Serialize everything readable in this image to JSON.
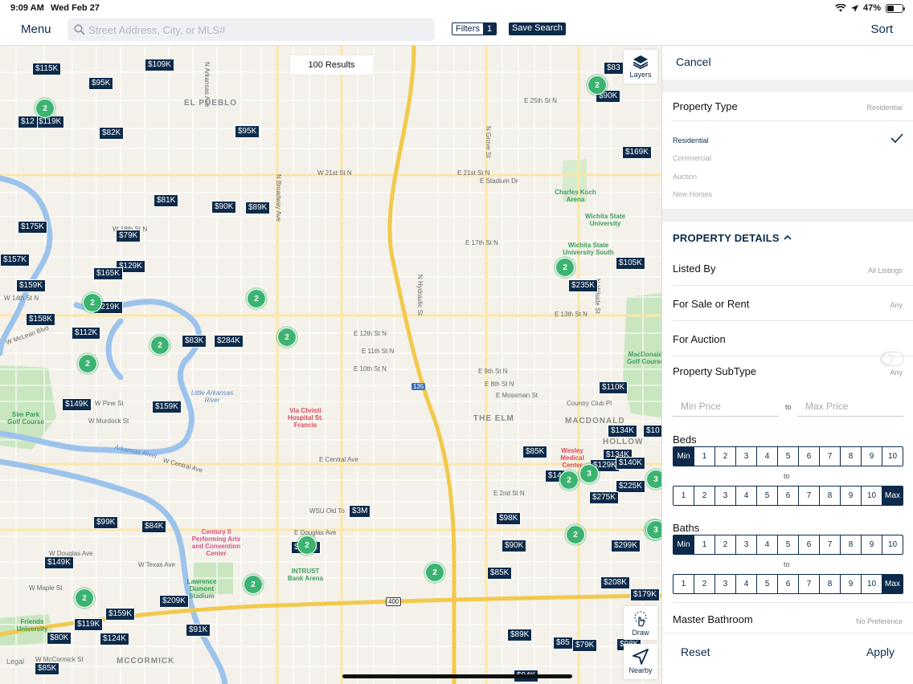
{
  "status": {
    "time": "9:09 AM",
    "date": "Wed Feb 27",
    "battery": "47%",
    "battery_level": 0.47
  },
  "topbar": {
    "menu_label": "Menu",
    "search_placeholder": "Street Address, City, or MLS#",
    "filters_label": "Filters",
    "filters_count": "1",
    "save_search_label": "Save Search",
    "sort_label": "Sort"
  },
  "map": {
    "results_label": "100 Results",
    "layers_label": "Layers",
    "draw_label": "Draw",
    "nearby_label": "Nearby",
    "legal_label": "Legal",
    "price_pins": [
      "$115K",
      "$109K",
      "$95K",
      "$119K",
      "$12",
      "$82K",
      "$95K",
      "$83",
      "$90K",
      "$169K",
      "$81K",
      "$90K",
      "$89K",
      "$79K",
      "$175K",
      "$157K",
      "$129K",
      "$165K",
      "$159K",
      "$219K",
      "$158K",
      "$112K",
      "$83K",
      "$284K",
      "$105K",
      "$235K",
      "$110K",
      "$149K",
      "$159K",
      "$134K",
      "$134K",
      "$10",
      "$85K",
      "$14",
      "$129K",
      "$140K",
      "$225K",
      "$275K",
      "$3M",
      "$98K",
      "$99K",
      "$84K",
      "$259K",
      "$90K",
      "$85K",
      "$299K",
      "$149K",
      "$209K",
      "$208K",
      "$179K",
      "$159K",
      "$119K",
      "$91K",
      "$80K",
      "$124K",
      "$89K",
      "$85",
      "$79K",
      "$98K",
      "$85K",
      "$94K"
    ],
    "clusters": [
      "2",
      "2",
      "2",
      "2",
      "2",
      "2",
      "2",
      "2",
      "2",
      "3",
      "3",
      "2",
      "2",
      "2",
      "2",
      "2",
      "2",
      "3"
    ],
    "labels": {
      "el_pueblo": "EL PUEBLO",
      "the_elm": "THE ELM",
      "macdonald": "MACDONALD",
      "hollow": "HOLLOW",
      "mccormick": "MCCORMICK",
      "e25th": "E 25th St N",
      "e21st": "E 21st St N",
      "w21st": "W 21st St N",
      "e17th": "E 17th St N",
      "e13th": "E 13th St N",
      "e12th": "E 12th St N",
      "e11th": "E 11th St N",
      "e10th": "E 10th St N",
      "e9th": "E 9th St N",
      "e8th": "E 8th St N",
      "e_mossman": "E Mossman St",
      "e_central": "E Central Ave",
      "w_central": "W Central Ave",
      "e2nd": "E 2nd St N",
      "e_douglas": "E Douglas Ave",
      "w_douglas": "W Douglas Ave",
      "w_maple": "W Maple St",
      "w_mccormick": "W McCormick St",
      "w_texas": "W Texas Ave",
      "w_murdock": "W Murdock St",
      "w_pine": "W Pine St",
      "w_14th": "W 14th St N",
      "w_18th": "W 18th St N",
      "e_stadium": "E Stadium Dr",
      "w_mclean": "W McLean Blvd",
      "n_broadway": "N Broadway Ave",
      "n_hydraulic": "N Hydraulic St",
      "n_arkansas": "N Arkansas Ave",
      "n_grove": "N Grove St",
      "n_hillside": "N Hillside St",
      "arkansas_river": "Arkansas River",
      "little_arkansas": "Little Arkansas River",
      "charles_koch": "Charles Koch Arena",
      "wichita_state": "Wichita State University",
      "wsu_south": "Wichita State University South",
      "via_christi": "Via Christi Hospital St. Francis",
      "wesley": "Wesley Medical Center",
      "century_ii": "Century II Performing Arts and Convention Center",
      "lawrence_dumont": "Lawrence Dumont Stadium",
      "intrust": "INTRUST Bank Arena",
      "wsu_old_town": "WSU Old To",
      "friends_univ": "Friends University",
      "sim_park": "Sim Park Golf Course",
      "macdonald_golf": "MacDonald Golf Course",
      "country_club": "Country Club Pl",
      "hwy_135": "135",
      "hwy_400": "400"
    }
  },
  "panel": {
    "cancel_label": "Cancel",
    "property_type_label": "Property Type",
    "property_type_value": "Residential",
    "property_type_options": [
      "Residential",
      "Commercial",
      "Auction",
      "New Homes"
    ],
    "selected_property_type": "Residential",
    "details_title": "PROPERTY DETAILS",
    "listed_by_label": "Listed By",
    "listed_by_value": "All Listings",
    "sale_rent_label": "For Sale or Rent",
    "sale_rent_value": "Any",
    "auction_label": "For Auction",
    "auction_on": false,
    "subtype_label": "Property SubType",
    "subtype_value": "Any",
    "min_price_placeholder": "Min Price",
    "price_to": "to",
    "max_price_placeholder": "Max Price",
    "beds_label": "Beds",
    "beds_min_options": [
      "Min",
      "1",
      "2",
      "3",
      "4",
      "5",
      "6",
      "7",
      "8",
      "9",
      "10"
    ],
    "beds_max_options": [
      "1",
      "2",
      "3",
      "4",
      "5",
      "6",
      "7",
      "8",
      "9",
      "10",
      "Max"
    ],
    "beds_selected_min": "Min",
    "beds_selected_max": "Max",
    "beds_to": "to",
    "baths_label": "Baths",
    "baths_min_options": [
      "Min",
      "1",
      "2",
      "3",
      "4",
      "5",
      "6",
      "7",
      "8",
      "9",
      "10"
    ],
    "baths_max_options": [
      "1",
      "2",
      "3",
      "4",
      "5",
      "6",
      "7",
      "8",
      "9",
      "10",
      "Max"
    ],
    "baths_selected_min": "Min",
    "baths_selected_max": "Max",
    "baths_to": "to",
    "master_bath_label": "Master Bathroom",
    "master_bath_value": "No Preference",
    "reset_label": "Reset",
    "apply_label": "Apply"
  },
  "colors": {
    "brand": "#0d2a4a",
    "cluster": "#3cb371",
    "highway": "#f2c94c",
    "water": "#9cc3ec",
    "park": "#c9e6c0"
  }
}
